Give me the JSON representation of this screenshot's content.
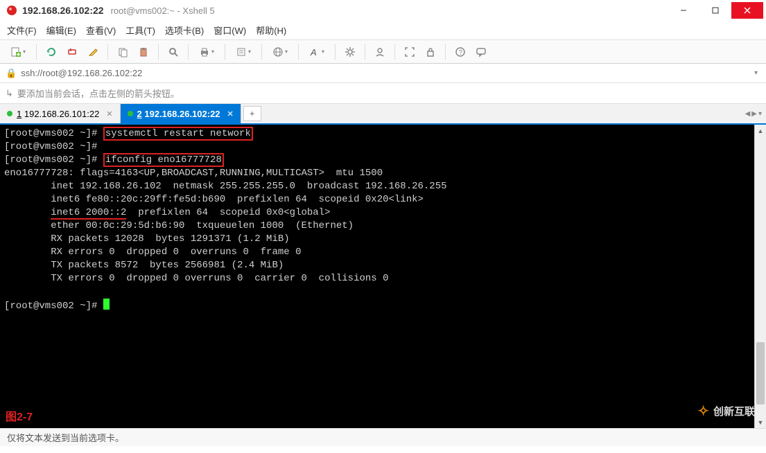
{
  "window": {
    "title_main": "192.168.26.102:22",
    "title_sub": "root@vms002:~ - Xshell 5"
  },
  "menus": [
    "文件(F)",
    "编辑(E)",
    "查看(V)",
    "工具(T)",
    "选项卡(B)",
    "窗口(W)",
    "帮助(H)"
  ],
  "address": {
    "url": "ssh://root@192.168.26.102:22"
  },
  "hint": "要添加当前会话，点击左侧的箭头按钮。",
  "tabs": [
    {
      "num": "1",
      "label": "192.168.26.101:22",
      "active": false
    },
    {
      "num": "2",
      "label": "192.168.26.102:22",
      "active": true
    }
  ],
  "term": {
    "p1": "[root@vms002 ~]# ",
    "cmd1": "systemctl restart network",
    "p2": "[root@vms002 ~]#",
    "p3": "[root@vms002 ~]# ",
    "cmd2": "ifconfig eno16777728",
    "out_head": "eno16777728: flags=4163<UP,BROADCAST,RUNNING,MULTICAST>  mtu 1500",
    "out_inet": "        inet 192.168.26.102  netmask 255.255.255.0  broadcast 192.168.26.255",
    "out_inet6a": "        inet6 fe80::20c:29ff:fe5d:b690  prefixlen 64  scopeid 0x20<link>",
    "out_inet6b_pre": "        ",
    "out_inet6b_hl": "inet6 2000::2",
    "out_inet6b_post": "  prefixlen 64  scopeid 0x0<global>",
    "out_ether": "        ether 00:0c:29:5d:b6:90  txqueuelen 1000  (Ethernet)",
    "out_rxp": "        RX packets 12028  bytes 1291371 (1.2 MiB)",
    "out_rxe": "        RX errors 0  dropped 0  overruns 0  frame 0",
    "out_txp": "        TX packets 8572  bytes 2566981 (2.4 MiB)",
    "out_txe": "        TX errors 0  dropped 0 overruns 0  carrier 0  collisions 0",
    "p4": "[root@vms002 ~]# "
  },
  "figure_label": "图2-7",
  "watermark_text": "创新互联",
  "status": "仅将文本发送到当前选项卡。"
}
